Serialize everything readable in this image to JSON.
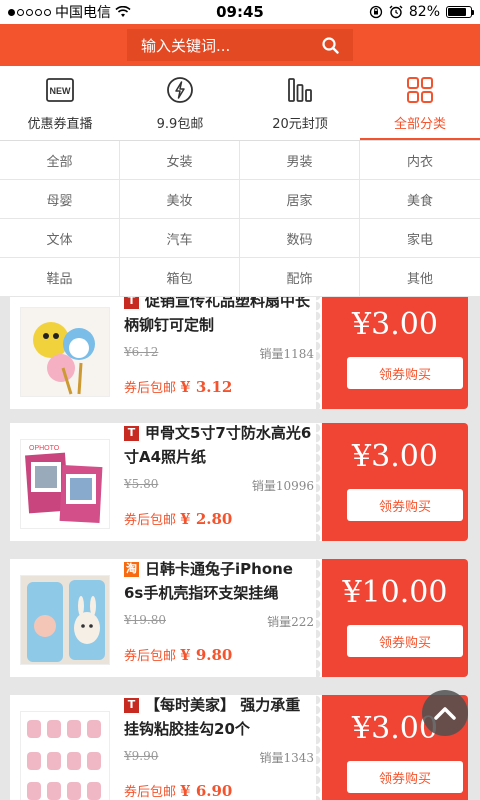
{
  "status_bar": {
    "carrier": "中国电信",
    "time": "09:45",
    "battery": "82%",
    "battery_level": 0.82
  },
  "search": {
    "placeholder": "输入关键词..."
  },
  "tabs": [
    {
      "label": "优惠券直播",
      "icon": "new-badge-icon"
    },
    {
      "label": "9.9包邮",
      "icon": "lightning-icon"
    },
    {
      "label": "20元封顶",
      "icon": "bars-icon"
    },
    {
      "label": "全部分类",
      "icon": "grid-icon",
      "active": true
    }
  ],
  "categories": [
    "全部",
    "女装",
    "男装",
    "内衣",
    "母婴",
    "美妆",
    "居家",
    "美食",
    "文体",
    "汽车",
    "数码",
    "家电",
    "鞋品",
    "箱包",
    "配饰",
    "其他"
  ],
  "products": [
    {
      "badge": "T",
      "title": "促销宣传礼品塑料扇中长柄铆钉可定制",
      "original_price": "¥6.12",
      "sales": "销量1184",
      "final_label": "券后包邮",
      "final_price": "¥ 3.12",
      "coupon_currency": "¥",
      "coupon_value": "3.00",
      "buy_label": "领券购买"
    },
    {
      "badge": "T",
      "title": "甲骨文5寸7寸防水高光6寸A4照片纸",
      "original_price": "¥5.80",
      "sales": "销量10996",
      "final_label": "券后包邮",
      "final_price": "¥ 2.80",
      "coupon_currency": "¥",
      "coupon_value": "3.00",
      "buy_label": "领券购买"
    },
    {
      "badge": "淘",
      "title": "日韩卡通兔子iPhone 6s手机壳指环支架挂绳",
      "original_price": "¥19.80",
      "sales": "销量222",
      "final_label": "券后包邮",
      "final_price": "¥ 9.80",
      "coupon_currency": "¥",
      "coupon_value": "10.00",
      "buy_label": "领券购买"
    },
    {
      "badge": "T",
      "title": "【每时美家】 强力承重挂钩粘胶挂勾20个",
      "original_price": "¥9.90",
      "sales": "销量1343",
      "final_label": "券后包邮",
      "final_price": "¥ 6.90",
      "coupon_currency": "¥",
      "coupon_value": "3.00",
      "buy_label": "领券购买"
    }
  ],
  "colors": {
    "accent": "#f4542d",
    "coupon": "#f04434",
    "badge_tmall": "#c62a20",
    "badge_taobao": "#f76a10"
  },
  "back_to_top_icon": "chevron-up-icon"
}
